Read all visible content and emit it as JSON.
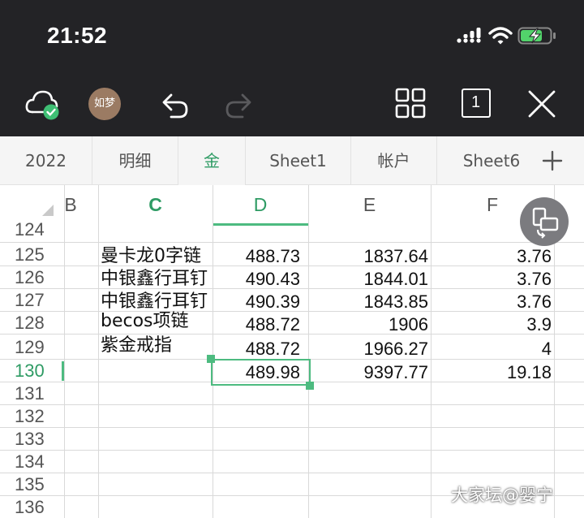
{
  "status_bar": {
    "time": "21:52"
  },
  "toolbar": {
    "avatar_text": "如梦",
    "cloud": "cloud-synced-icon",
    "undo": "undo-icon",
    "redo": "redo-icon",
    "grid_view": "grid-view-icon",
    "sheet_count": "1",
    "close": "close-icon"
  },
  "tabs": [
    "2022",
    "明细",
    "金",
    "Sheet1",
    "帐户",
    "Sheet6"
  ],
  "active_tab": "金",
  "columns": [
    "B",
    "C",
    "D",
    "E",
    "F"
  ],
  "selected_column": "D",
  "rows": [
    {
      "num": "124",
      "c": "",
      "d": "",
      "e": "",
      "f": ""
    },
    {
      "num": "125",
      "c": "曼卡龙0字链",
      "d": "488.73",
      "e": "1837.64",
      "f": "3.76"
    },
    {
      "num": "126",
      "c": "中银鑫行耳钉",
      "d": "490.43",
      "e": "1844.01",
      "f": "3.76"
    },
    {
      "num": "127",
      "c": "中银鑫行耳钉",
      "d": "490.39",
      "e": "1843.85",
      "f": "3.76"
    },
    {
      "num": "128",
      "c": "becos项链",
      "d": "488.72",
      "e": "1906",
      "f": "3.9"
    },
    {
      "num": "129",
      "c": "紫金戒指",
      "d": "488.72",
      "e": "1966.27",
      "f": "4"
    },
    {
      "num": "130",
      "c": "",
      "d": "489.98",
      "e": "9397.77",
      "f": "19.18"
    },
    {
      "num": "131",
      "c": "",
      "d": "",
      "e": "",
      "f": ""
    },
    {
      "num": "132",
      "c": "",
      "d": "",
      "e": "",
      "f": ""
    },
    {
      "num": "133",
      "c": "",
      "d": "",
      "e": "",
      "f": ""
    },
    {
      "num": "134",
      "c": "",
      "d": "",
      "e": "",
      "f": ""
    },
    {
      "num": "135",
      "c": "",
      "d": "",
      "e": "",
      "f": ""
    },
    {
      "num": "136",
      "c": "",
      "d": "",
      "e": "",
      "f": ""
    }
  ],
  "selected_row": "130",
  "watermark": "大家坛@婴宁",
  "colors": {
    "accent": "#4dbb80",
    "accent_text": "#2e9b64",
    "topbar": "#232326"
  }
}
